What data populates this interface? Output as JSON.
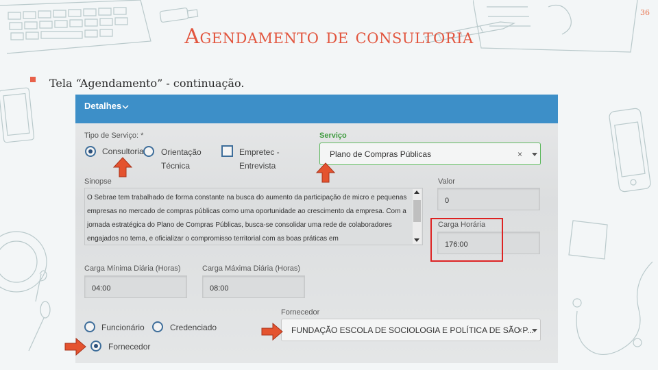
{
  "slide": {
    "number": "36",
    "title": "Agendamento de consultoria",
    "bullet": "Tela “Agendamento” - continuação."
  },
  "colors": {
    "title": "#e2553e",
    "header_bar": "#3d8fc8",
    "highlight": "#dd2222",
    "arrow": "#e4532f"
  },
  "form": {
    "header_label": "Detalhes",
    "tipo_servico_label": "Tipo de Serviço: *",
    "tipo_options": [
      {
        "label": "Consultoria",
        "selected": true
      },
      {
        "label_line1": "Orientação",
        "label_line2": "Técnica",
        "selected": false
      },
      {
        "label_line1": "Empretec -",
        "label_line2": "Entrevista",
        "checked": false
      }
    ],
    "servico": {
      "label": "Serviço",
      "value": "Plano de Compras Públicas",
      "clear": "×"
    },
    "sinopse": {
      "label": "Sinopse",
      "text": "O Sebrae tem trabalhado de forma constante na busca do aumento da participação de micro e pequenas empresas no mercado de compras públicas como uma oportunidade ao crescimento da empresa. Com a jornada estratégica do Plano de Compras Públicas, busca-se consolidar uma rede de colaboradores engajados no tema, e oficializar o compromisso territorial com as boas práticas em"
    },
    "valor": {
      "label": "Valor",
      "value": "0"
    },
    "carga_horaria": {
      "label": "Carga Horária",
      "value": "176:00"
    },
    "carga_minima": {
      "label": "Carga Mínima Diária (Horas)",
      "value": "04:00"
    },
    "carga_maxima": {
      "label": "Carga Máxima Diária (Horas)",
      "value": "08:00"
    },
    "fornecedor": {
      "label": "Fornecedor",
      "value": "FUNDAÇÃO ESCOLA DE SOCIOLOGIA E POLÍTICA DE SÃO P...",
      "clear": "×"
    },
    "tipo_pessoa_options": [
      {
        "label": "Funcionário",
        "selected": false
      },
      {
        "label": "Credenciado",
        "selected": false
      },
      {
        "label": "Fornecedor",
        "selected": true
      }
    ]
  }
}
